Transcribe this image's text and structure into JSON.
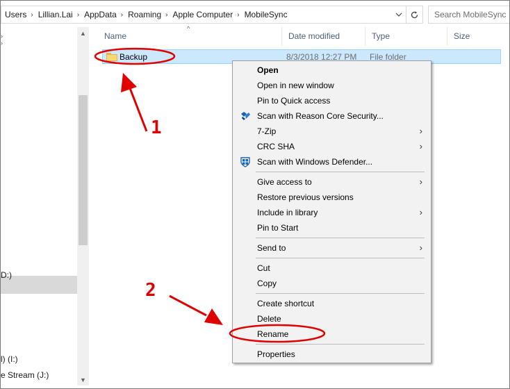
{
  "address_bar": {
    "breadcrumbs": [
      "Users",
      "Lillian.Lai",
      "AppData",
      "Roaming",
      "Apple Computer",
      "MobileSync"
    ],
    "dropdown_icon": "chevron-down-icon",
    "refresh_icon": "refresh-icon"
  },
  "search": {
    "placeholder": "Search MobileSync"
  },
  "nav_pane": {
    "items": [
      "D:)",
      "l) (I:)",
      "e Stream (J:)"
    ]
  },
  "columns": [
    "Name",
    "Date modified",
    "Type",
    "Size"
  ],
  "files": [
    {
      "name": "Backup",
      "date_modified": "8/3/2018 12:27 PM",
      "type": "File folder",
      "size": ""
    }
  ],
  "context_menu": {
    "items": [
      {
        "label": "Open",
        "bold": true
      },
      {
        "label": "Open in new window"
      },
      {
        "label": "Pin to Quick access"
      },
      {
        "label": "Scan with Reason Core Security...",
        "icon": "reason-core-shield-icon"
      },
      {
        "label": "7-Zip",
        "submenu": true
      },
      {
        "label": "CRC SHA",
        "submenu": true
      },
      {
        "label": "Scan with Windows Defender...",
        "icon": "windows-defender-icon"
      },
      {
        "label": "Give access to",
        "submenu": true
      },
      {
        "label": "Restore previous versions"
      },
      {
        "label": "Include in library",
        "submenu": true
      },
      {
        "label": "Pin to Start"
      },
      {
        "label": "Send to",
        "submenu": true
      },
      {
        "label": "Cut"
      },
      {
        "label": "Copy"
      },
      {
        "label": "Create shortcut"
      },
      {
        "label": "Delete"
      },
      {
        "label": "Rename"
      },
      {
        "label": "Properties"
      }
    ]
  },
  "annotations": {
    "step1": "1",
    "step2": "2",
    "color": "#e00000"
  },
  "colors": {
    "selection_bg": "#cce8ff",
    "selection_border": "#99d1ff",
    "menu_bg": "#f2f2f2",
    "header_text": "#4c607a"
  }
}
